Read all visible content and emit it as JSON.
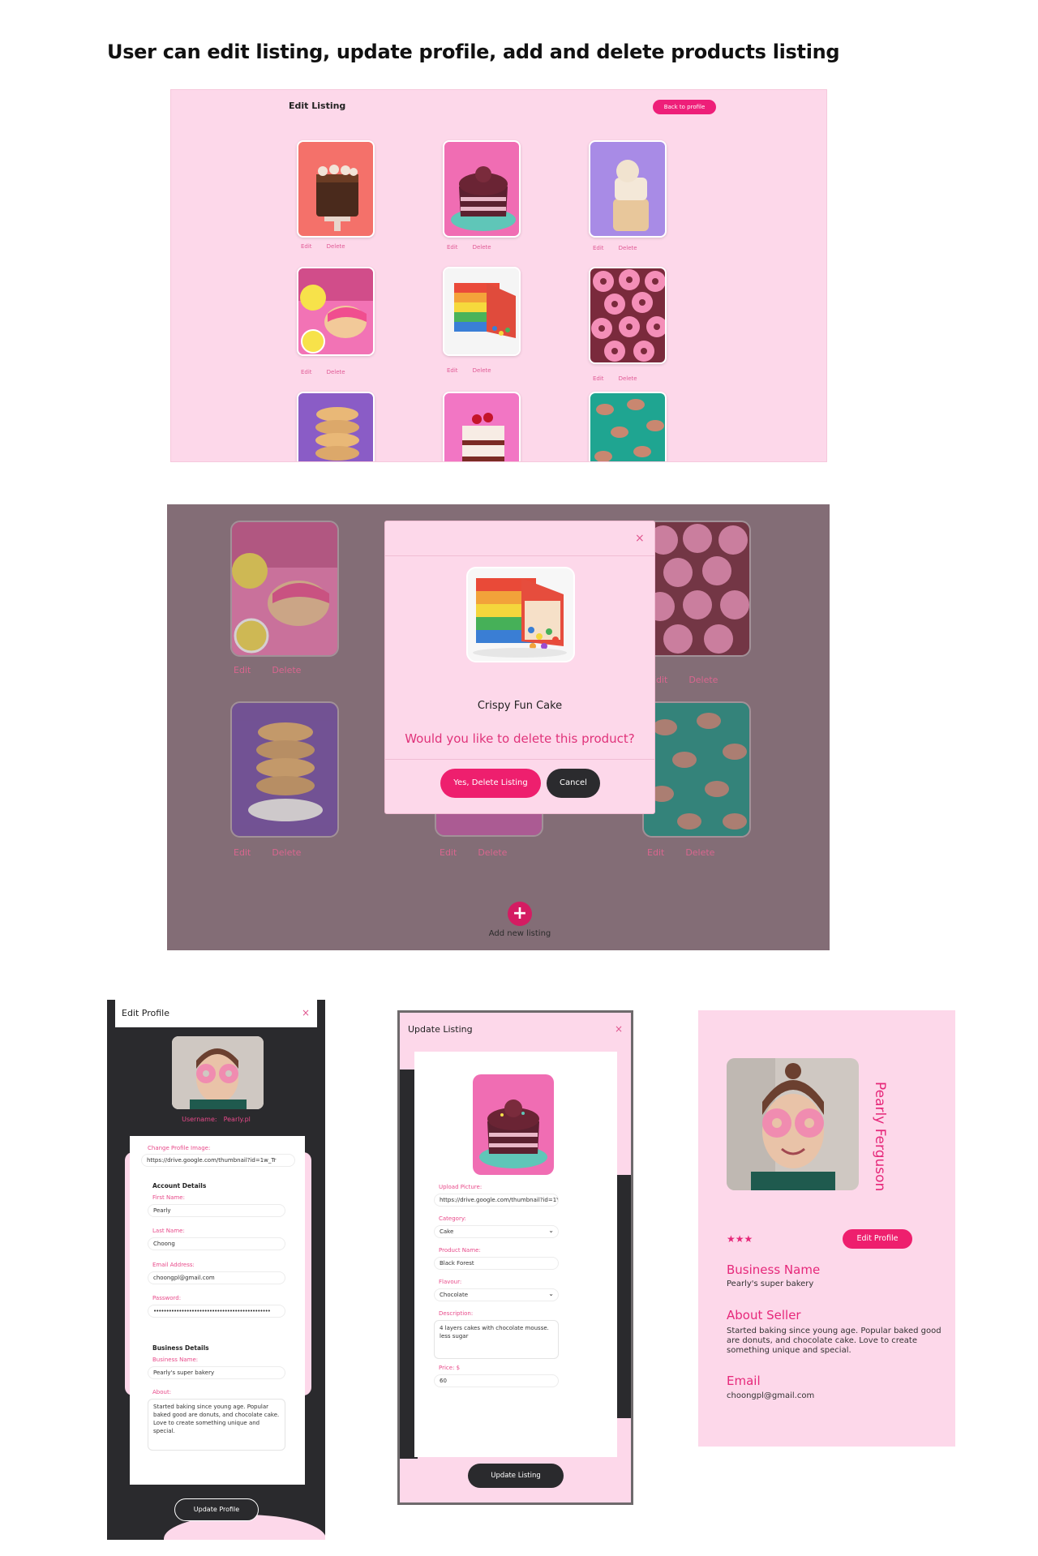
{
  "page_heading": "User can edit listing, update profile, add and delete products listing",
  "edit_listing": {
    "title": "Edit Listing",
    "back_button": "Back to profile",
    "edit_label": "Edit",
    "delete_label": "Delete"
  },
  "delete_modal": {
    "close_icon": "×",
    "product_name": "Crispy Fun Cake",
    "question": "Would you like to delete this product?",
    "confirm_button": "Yes, Delete Listing",
    "cancel_button": "Cancel",
    "edit_label": "Edit",
    "delete_label": "Delete",
    "add_icon": "+",
    "add_label": "Add new listing"
  },
  "edit_profile": {
    "title": "Edit Profile",
    "close_icon": "×",
    "username_label": "Username:",
    "username": "Pearly.pl",
    "change_image_label": "Change Profile Image:",
    "image_url": "https://drive.google.com/thumbnail?id=1w_Tr",
    "account_details": "Account Details",
    "first_name_label": "First Name:",
    "first_name": "Pearly",
    "last_name_label": "Last Name:",
    "last_name": "Choong",
    "email_label": "Email Address:",
    "email": "choongpl@gmail.com",
    "password_label": "Password:",
    "password": "••••••••••••••••••••••••••••••••••••••••••••••",
    "business_details": "Business Details",
    "business_name_label": "Business Name:",
    "business_name": "Pearly's super bakery",
    "about_label": "About:",
    "about": "Started baking since young age. Popular baked good are donuts, and chocolate cake.  Love to create something unique and special.",
    "update_button": "Update Profile"
  },
  "update_listing": {
    "title": "Update Listing",
    "close_icon": "×",
    "upload_label": "Upload Picture:",
    "upload_url": "https://drive.google.com/thumbnail?id=1Y",
    "category_label": "Category:",
    "category": "Cake",
    "product_name_label": "Product Name:",
    "product_name": "Black Forest",
    "flavour_label": "Flavour:",
    "flavour": "Chocolate",
    "description_label": "Description:",
    "description": "4 layers cakes with chocolate mousse. less sugar",
    "price_label": "Price: $",
    "price": "60",
    "update_button": "Update Listing",
    "dropdown_icon": "⌄"
  },
  "profile": {
    "name": "Pearly Ferguson",
    "stars": "★★★",
    "edit_button": "Edit Profile",
    "business_heading": "Business Name",
    "business_name": "Pearly's super bakery",
    "about_heading": "About Seller",
    "about": "Started baking since young age. Popular baked good are donuts, and chocolate cake. Love to create something unique and special.",
    "email_heading": "Email",
    "email": "choongpl@gmail.com"
  },
  "colors": {
    "brand_pink": "#ee1f79",
    "panel_pink": "#fdd8ea",
    "dark": "#2a2a2d",
    "overlay": "#836d76"
  }
}
